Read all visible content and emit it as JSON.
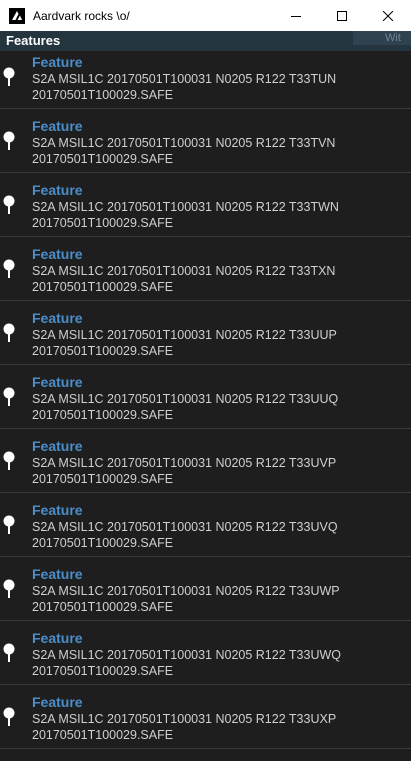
{
  "window": {
    "title": "Aardvark rocks \\o/",
    "minimize_icon": "minimize-icon",
    "maximize_icon": "maximize-icon",
    "close_icon": "close-icon"
  },
  "panel": {
    "title": "Features",
    "ghost_tab": "Wit"
  },
  "colors": {
    "feature_name": "#4d8ec9",
    "header_bg": "#253540",
    "list_bg": "#1e1e1e"
  },
  "features": [
    {
      "name": "Feature",
      "description": "S2A MSIL1C 20170501T100031 N0205 R122 T33TUN 20170501T100029.SAFE",
      "icon": "map-pin-icon"
    },
    {
      "name": "Feature",
      "description": "S2A MSIL1C 20170501T100031 N0205 R122 T33TVN 20170501T100029.SAFE",
      "icon": "map-pin-icon"
    },
    {
      "name": "Feature",
      "description": "S2A MSIL1C 20170501T100031 N0205 R122 T33TWN 20170501T100029.SAFE",
      "icon": "map-pin-icon"
    },
    {
      "name": "Feature",
      "description": "S2A MSIL1C 20170501T100031 N0205 R122 T33TXN 20170501T100029.SAFE",
      "icon": "map-pin-icon"
    },
    {
      "name": "Feature",
      "description": "S2A MSIL1C 20170501T100031 N0205 R122 T33UUP 20170501T100029.SAFE",
      "icon": "map-pin-icon"
    },
    {
      "name": "Feature",
      "description": "S2A MSIL1C 20170501T100031 N0205 R122 T33UUQ 20170501T100029.SAFE",
      "icon": "map-pin-icon"
    },
    {
      "name": "Feature",
      "description": "S2A MSIL1C 20170501T100031 N0205 R122 T33UVP 20170501T100029.SAFE",
      "icon": "map-pin-icon"
    },
    {
      "name": "Feature",
      "description": "S2A MSIL1C 20170501T100031 N0205 R122 T33UVQ 20170501T100029.SAFE",
      "icon": "map-pin-icon"
    },
    {
      "name": "Feature",
      "description": "S2A MSIL1C 20170501T100031 N0205 R122 T33UWP 20170501T100029.SAFE",
      "icon": "map-pin-icon"
    },
    {
      "name": "Feature",
      "description": "S2A MSIL1C 20170501T100031 N0205 R122 T33UWQ 20170501T100029.SAFE",
      "icon": "map-pin-icon"
    },
    {
      "name": "Feature",
      "description": "S2A MSIL1C 20170501T100031 N0205 R122 T33UXP 20170501T100029.SAFE",
      "icon": "map-pin-icon"
    }
  ]
}
